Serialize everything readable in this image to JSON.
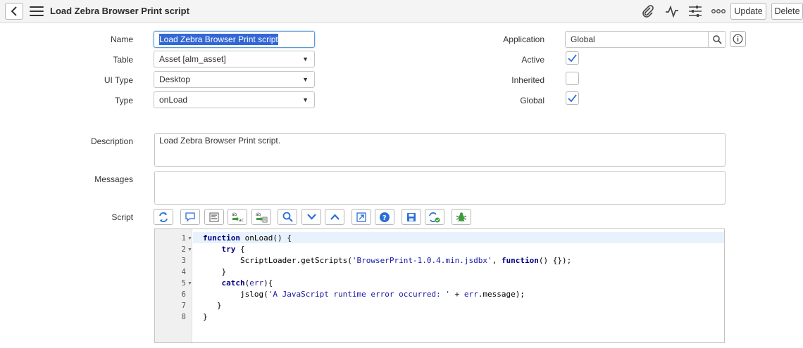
{
  "header": {
    "title": "Load Zebra Browser Print script",
    "update_label": "Update",
    "delete_label": "Delete",
    "icons": [
      "back-icon",
      "menu-icon",
      "paperclip-icon",
      "activity-icon",
      "sliders-icon",
      "more-icon"
    ]
  },
  "form": {
    "name_label": "Name",
    "name_value": "Load Zebra Browser Print script",
    "table_label": "Table",
    "table_value": "Asset [alm_asset]",
    "ui_type_label": "UI Type",
    "ui_type_value": "Desktop",
    "type_label": "Type",
    "type_value": "onLoad",
    "application_label": "Application",
    "application_value": "Global",
    "active_label": "Active",
    "active_checked": true,
    "inherited_label": "Inherited",
    "inherited_checked": false,
    "global_label": "Global",
    "global_checked": true,
    "description_label": "Description",
    "description_value": "Load Zebra Browser Print script.",
    "messages_label": "Messages",
    "messages_value": "",
    "script_label": "Script"
  },
  "toolbar_icons": [
    "toggle-syntax-icon",
    "comment-icon",
    "format-icon",
    "replace-icon",
    "replace-all-icon",
    "search-icon",
    "next-icon",
    "previous-icon",
    "fullscreen-icon",
    "help-icon",
    "save-icon",
    "script-debugger-icon",
    "debug-icon"
  ],
  "script": {
    "line_numbers": [
      "1",
      "2",
      "3",
      "4",
      "5",
      "6",
      "7",
      "8"
    ],
    "lines": [
      "function onLoad() {",
      "    try {",
      "        ScriptLoader.getScripts('BrowserPrint-1.0.4.min.jsdbx', function() {});",
      "    }",
      "    catch(err){",
      "        jslog('A JavaScript runtime error occurred: ' + err.message);",
      "   }",
      "}"
    ]
  },
  "colors": {
    "accent": "#2b6fd6",
    "header_bg": "#f4f4f4",
    "keyword": "#000080",
    "string": "#1a1aa6"
  }
}
